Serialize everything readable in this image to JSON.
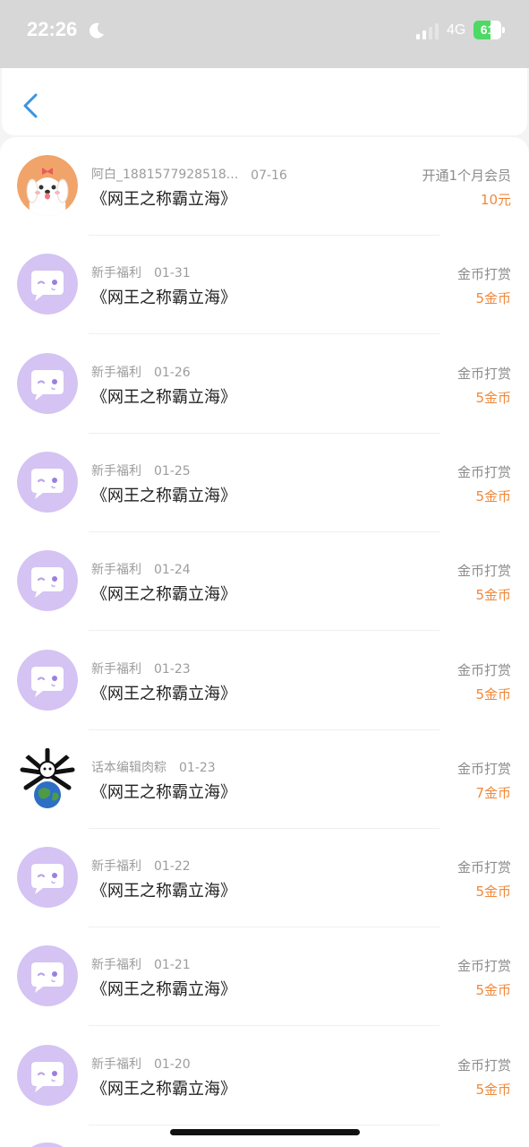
{
  "status_bar": {
    "time": "22:26",
    "network": "4G",
    "battery_level": "61",
    "battery_percent": 61
  },
  "header": {
    "back_icon": "chevron-left-icon",
    "accent_color": "#3a95e0"
  },
  "list": {
    "amount_color": "#f0883a",
    "items": [
      {
        "name": "阿白_1881577928518...",
        "date": "07-16",
        "title": "《网王之称霸立海》",
        "action": "开通1个月会员",
        "amount": "10元",
        "avatar": "dog-avatar"
      },
      {
        "name": "新手福利",
        "date": "01-31",
        "title": "《网王之称霸立海》",
        "action": "金币打赏",
        "amount": "5金币",
        "avatar": "chat-bubble-avatar"
      },
      {
        "name": "新手福利",
        "date": "01-26",
        "title": "《网王之称霸立海》",
        "action": "金币打赏",
        "amount": "5金币",
        "avatar": "chat-bubble-avatar"
      },
      {
        "name": "新手福利",
        "date": "01-25",
        "title": "《网王之称霸立海》",
        "action": "金币打赏",
        "amount": "5金币",
        "avatar": "chat-bubble-avatar"
      },
      {
        "name": "新手福利",
        "date": "01-24",
        "title": "《网王之称霸立海》",
        "action": "金币打赏",
        "amount": "5金币",
        "avatar": "chat-bubble-avatar"
      },
      {
        "name": "新手福利",
        "date": "01-23",
        "title": "《网王之称霸立海》",
        "action": "金币打赏",
        "amount": "5金币",
        "avatar": "chat-bubble-avatar"
      },
      {
        "name": "话本编辑肉粽",
        "date": "01-23",
        "title": "《网王之称霸立海》",
        "action": "金币打赏",
        "amount": "7金币",
        "avatar": "globe-avatar"
      },
      {
        "name": "新手福利",
        "date": "01-22",
        "title": "《网王之称霸立海》",
        "action": "金币打赏",
        "amount": "5金币",
        "avatar": "chat-bubble-avatar"
      },
      {
        "name": "新手福利",
        "date": "01-21",
        "title": "《网王之称霸立海》",
        "action": "金币打赏",
        "amount": "5金币",
        "avatar": "chat-bubble-avatar"
      },
      {
        "name": "新手福利",
        "date": "01-20",
        "title": "《网王之称霸立海》",
        "action": "金币打赏",
        "amount": "5金币",
        "avatar": "chat-bubble-avatar"
      }
    ]
  }
}
